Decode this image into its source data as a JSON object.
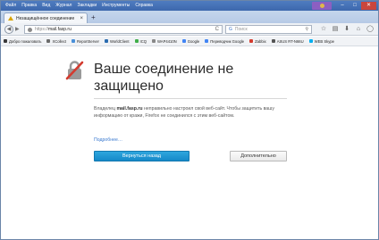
{
  "menu": {
    "items": [
      "Файл",
      "Правка",
      "Вид",
      "Журнал",
      "Закладки",
      "Инструменты",
      "Справка"
    ]
  },
  "window": {
    "minimize": "–",
    "maximize": "□",
    "close": "✕"
  },
  "tab": {
    "title": "Незащищённое соединение",
    "close": "×",
    "new_tab": "+"
  },
  "navbar": {
    "back": "◀",
    "forward": "▶",
    "url_prefix": "https://",
    "url_host": "mail.fasp.ru",
    "url_tools": "C",
    "search_engine": "G",
    "search_placeholder": "Поиск",
    "search_button": "⚲",
    "icons": [
      "star-icon",
      "bookmarks-icon",
      "download-icon",
      "home-icon",
      "chat-icon",
      "menu-icon"
    ]
  },
  "bookmarks": [
    {
      "label": "Добро пожаловать",
      "color": "#3a3a3a"
    },
    {
      "label": "XCollect",
      "color": "#6b6b6b"
    },
    {
      "label": "ReportServer",
      "color": "#4a90d9"
    },
    {
      "label": "WorldClient",
      "color": "#2b6cb0"
    },
    {
      "label": "ICQ",
      "color": "#3fae49"
    },
    {
      "label": "WAP4410N",
      "color": "#888888"
    },
    {
      "label": "Google",
      "color": "#4285f4"
    },
    {
      "label": "Переводчик Google",
      "color": "#4285f4"
    },
    {
      "label": "Zabbix",
      "color": "#d43b2f"
    },
    {
      "label": "ASUS RT-N66U",
      "color": "#555555"
    },
    {
      "label": "WEB Skype",
      "color": "#00aff0"
    }
  ],
  "page": {
    "title": "Ваше соединение не защищено",
    "desc_before": "Владелец ",
    "desc_host": "mail.fasp.ru",
    "desc_after": " неправильно настроил свой веб-сайт. Чтобы защитить вашу информацию от кражи, Firefox не соединился с этим веб-сайтом.",
    "more_link": "Подробнее…",
    "back_button": "Вернуться назад",
    "advanced_button": "Дополнительно"
  },
  "colors": {
    "primary_button": "#1589c8",
    "link": "#3b7ad0",
    "warning": "#d33b2f"
  }
}
